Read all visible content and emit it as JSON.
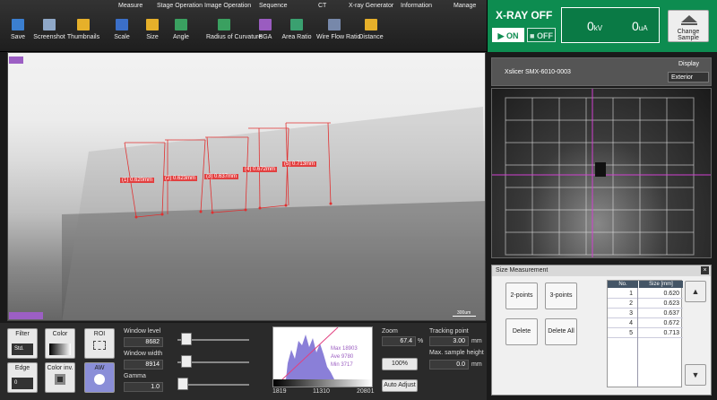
{
  "menus": [
    "Measure",
    "Stage Operation",
    "Image Operation",
    "Sequence",
    "CT",
    "X-ray Generator",
    "Information",
    "Manage"
  ],
  "toolbar": [
    {
      "label": "Save",
      "icon": "save-icon",
      "color": "#3b7fd0"
    },
    {
      "label": "Screenshot",
      "icon": "screenshot-icon",
      "color": "#8fa8c8"
    },
    {
      "label": "Thumbnails",
      "icon": "folder-icon",
      "color": "#e6b02a"
    },
    {
      "label": "Scale",
      "icon": "scale-icon",
      "color": "#3b6fc8"
    },
    {
      "label": "Size",
      "icon": "size-icon",
      "color": "#e6b02a"
    },
    {
      "label": "Angle",
      "icon": "angle-icon",
      "color": "#3aa060"
    },
    {
      "label": "Radius of Curvature",
      "icon": "curvature-icon",
      "color": "#3aa060"
    },
    {
      "label": "BGA",
      "icon": "bga-icon",
      "color": "#9a5cc0"
    },
    {
      "label": "Area Ratio",
      "icon": "area-ratio-icon",
      "color": "#3aa070"
    },
    {
      "label": "Wire Flow Ratio",
      "icon": "wire-flow-icon",
      "color": "#7788aa"
    },
    {
      "label": "Distance",
      "icon": "distance-icon",
      "color": "#e6b02a"
    }
  ],
  "xray": {
    "title": "X-RAY OFF",
    "on_label": "▶ ON",
    "off_label": "■ OFF",
    "kv": "0",
    "kv_unit": "kV",
    "ua": "0",
    "ua_unit": "uA",
    "change_label": "Change Sample"
  },
  "camera": {
    "model": "Xslicer SMX-6010-0003",
    "display_label": "Display",
    "display_value": "Exterior"
  },
  "viewer": {
    "scale_text": "300um",
    "labels": [
      "(1) 0.620mm",
      "(2) 0.623mm",
      "(3) 0.637mm",
      "(4) 0.672mm",
      "(5) 0.713mm"
    ]
  },
  "controls": {
    "filter_label": "Filter",
    "filter_value": "Std.",
    "color_label": "Color",
    "roi_label": "ROI",
    "edge_label": "Edge",
    "edge_value": "0",
    "color_inv_label": "Color inv.",
    "aw_label": "AW",
    "window_level_label": "Window level",
    "window_level": "8682",
    "window_width_label": "Window width",
    "window_width": "8914",
    "gamma_label": "Gamma",
    "gamma": "1.0",
    "hist_min": "1819",
    "hist_mid": "11310",
    "hist_max": "20801",
    "hist_stats": [
      "Max 18903",
      "Ave 9780",
      "Min 3717"
    ],
    "zoom_label": "Zoom",
    "zoom": "67.4",
    "zoom_unit": "%",
    "zoom_100": "100%",
    "tracking_label": "Tracking point",
    "tracking": "3.00",
    "tracking_unit": "mm",
    "max_height_label": "Max. sample height",
    "max_height": "0.0",
    "max_height_unit": "mm",
    "auto_adjust": "Auto Adjust"
  },
  "size_measurement": {
    "title": "Size Measurement",
    "btn_2points": "2-points",
    "btn_3points": "3-points",
    "btn_delete": "Delete",
    "btn_delete_all": "Delete All",
    "col_no": "No.",
    "col_size": "Size [mm]",
    "rows": [
      {
        "no": "1",
        "size": "0.620"
      },
      {
        "no": "2",
        "size": "0.623"
      },
      {
        "no": "3",
        "size": "0.637"
      },
      {
        "no": "4",
        "size": "0.672"
      },
      {
        "no": "5",
        "size": "0.713"
      }
    ]
  }
}
